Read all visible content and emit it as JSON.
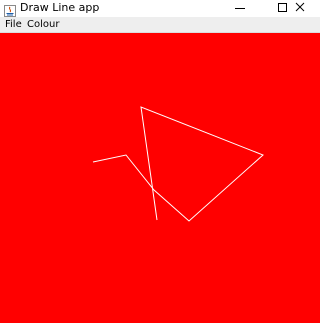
{
  "window": {
    "title": "Draw Line app",
    "icon": "java-app-icon",
    "controls": {
      "minimize_icon": "minimize-icon",
      "maximize_icon": "maximize-icon",
      "close_icon": "close-icon"
    }
  },
  "menubar": {
    "items": [
      {
        "label": "File"
      },
      {
        "label": "Colour"
      }
    ]
  },
  "canvas": {
    "background_color": "#ff0000",
    "line_color": "#ffffff"
  }
}
